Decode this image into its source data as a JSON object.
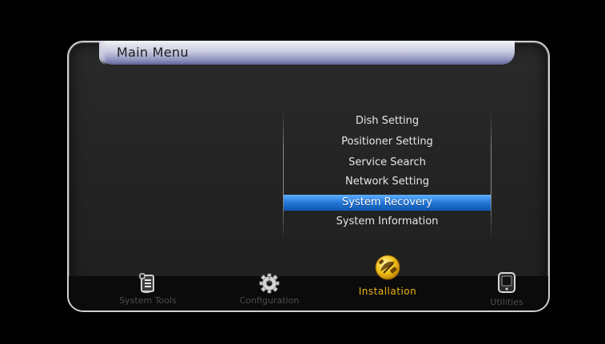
{
  "header": {
    "title": "Main Menu"
  },
  "submenu": {
    "items": [
      {
        "label": "Dish Setting",
        "selected": false
      },
      {
        "label": "Positioner Setting",
        "selected": false
      },
      {
        "label": "Service Search",
        "selected": false
      },
      {
        "label": "Network Setting",
        "selected": false
      },
      {
        "label": "System Recovery",
        "selected": true
      },
      {
        "label": "System Information",
        "selected": false
      }
    ]
  },
  "tabs": [
    {
      "label": "System Tools",
      "icon": "notepad-icon",
      "active": false
    },
    {
      "label": "Configuration",
      "icon": "gear-icon",
      "active": false
    },
    {
      "label": "Installation",
      "icon": "satellite-icon",
      "active": true
    },
    {
      "label": "Utilities",
      "icon": "tablet-icon",
      "active": false
    }
  ],
  "colors": {
    "selection": "#2477d8",
    "active_tab_label": "#f0b114",
    "inactive_tab_label": "#4d4d4d",
    "menu_text": "#e6e6e6"
  }
}
